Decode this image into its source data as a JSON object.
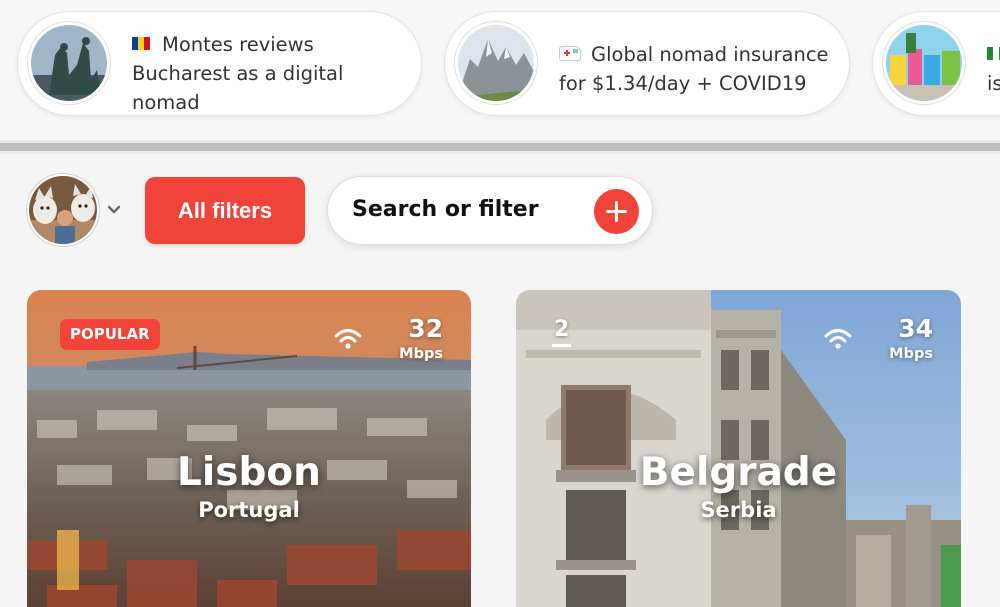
{
  "stories": [
    {
      "flag": "romania-flag",
      "text_line1": "Montes reviews",
      "text_line2": "Bucharest as a digital",
      "text_line3": "nomad"
    },
    {
      "icon": "ambulance-icon",
      "text_line1": "Global nomad insurance",
      "text_line2": "for $1.34/day + COVID19"
    },
    {
      "text_line1": "is"
    }
  ],
  "filters": {
    "all_filters_label": "All filters",
    "search_label": "Search or filter"
  },
  "cards": [
    {
      "badge": "POPULAR",
      "speed": "32",
      "unit": "Mbps",
      "city": "Lisbon",
      "country": "Portugal"
    },
    {
      "rank": "2",
      "speed": "34",
      "unit": "Mbps",
      "city": "Belgrade",
      "country": "Serbia"
    }
  ],
  "colors": {
    "accent": "#f0443a",
    "background": "#f5f5f5"
  }
}
